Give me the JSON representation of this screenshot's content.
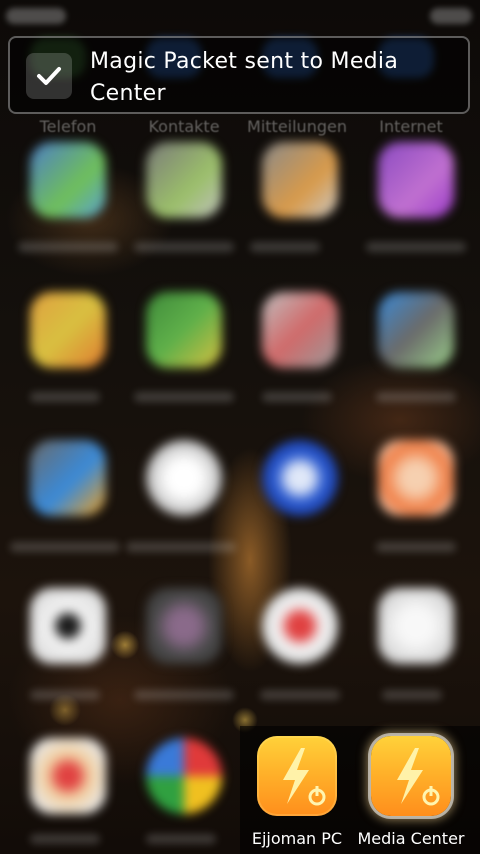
{
  "top_row": {
    "labels": [
      "Telefon",
      "Kontakte",
      "Mitteilungen",
      "Internet"
    ]
  },
  "notification": {
    "message": "Magic Packet sent to Media Center",
    "icon": "check-icon"
  },
  "shortcuts": [
    {
      "label": "Ejjoman PC",
      "icon": "lightning-power-icon",
      "selected": false
    },
    {
      "label": "Media Center",
      "icon": "lightning-power-icon",
      "selected": true
    }
  ],
  "colors": {
    "app_gradient_top": "#ffd23a",
    "app_gradient_bottom": "#ff8e1c",
    "banner_border": "#9a9a9a"
  }
}
